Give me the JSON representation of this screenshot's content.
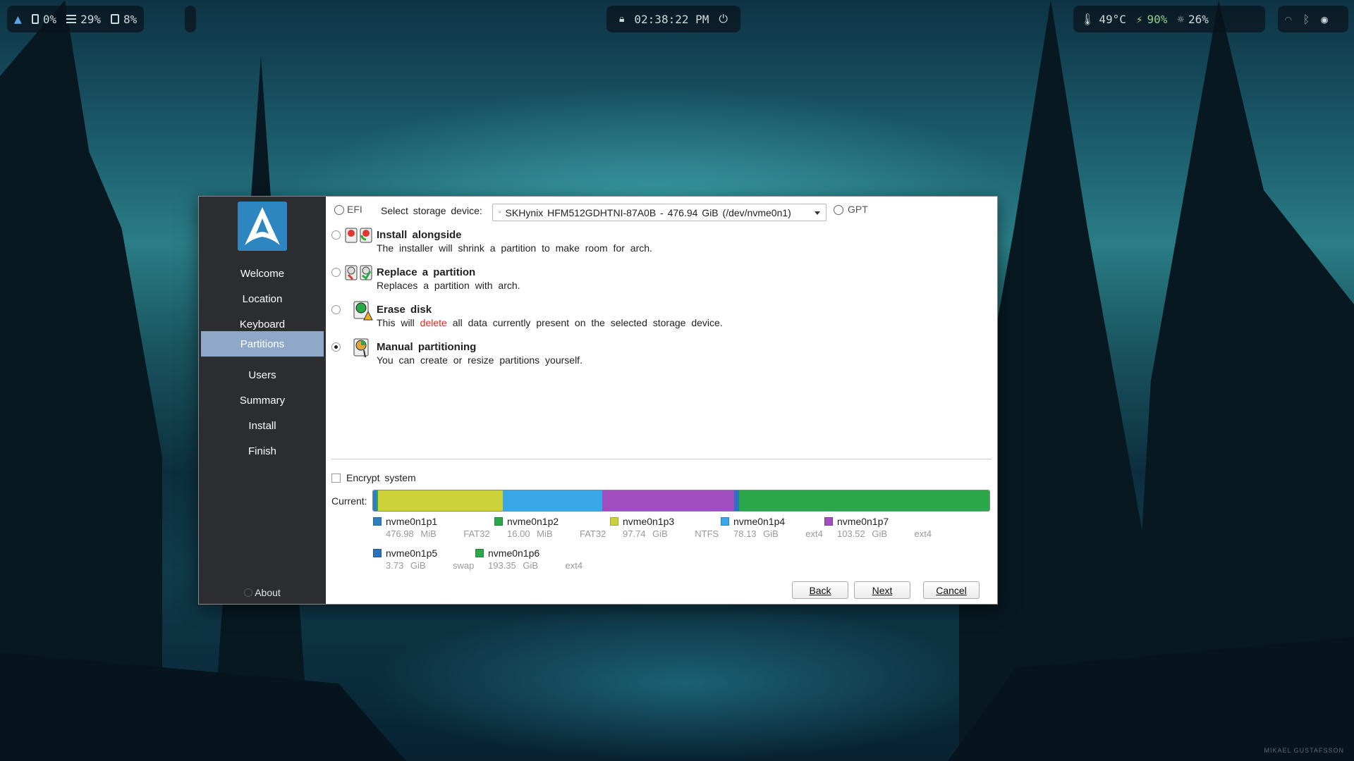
{
  "topbar": {
    "left": {
      "cpu": "0%",
      "memory": "29%",
      "disk": "8%"
    },
    "center": {
      "time": "02:38:22 PM"
    },
    "right": {
      "temperature": "49°C",
      "battery": "90%",
      "brightness": "26%"
    }
  },
  "sidebar": {
    "items": [
      {
        "label": "Welcome"
      },
      {
        "label": "Location"
      },
      {
        "label": "Keyboard"
      },
      {
        "label": "Partitions",
        "active": true
      },
      {
        "label": "Users"
      },
      {
        "label": "Summary"
      },
      {
        "label": "Install"
      },
      {
        "label": "Finish"
      }
    ],
    "about": "About"
  },
  "header": {
    "efi": "EFI",
    "select_label": "Select storage device:",
    "device": "SKHynix HFM512GDHTNI-87A0B - 476.94 GiB (/dev/nvme0n1)",
    "gpt": "GPT"
  },
  "options": [
    {
      "title": "Install alongside",
      "desc": "The installer will shrink a partition to make room for arch.",
      "selected": false
    },
    {
      "title": "Replace a partition",
      "desc": "Replaces a partition with arch.",
      "selected": false
    },
    {
      "title": "Erase disk",
      "desc_pre": "This will",
      "desc_red": "delete",
      "desc_post": "all data currently present on the selected storage device.",
      "selected": false
    },
    {
      "title": "Manual partitioning",
      "desc": "You can create or resize partitions yourself.",
      "selected": true
    }
  ],
  "encrypt_label": "Encrypt system",
  "current_label": "Current:",
  "partitions": [
    {
      "name": "nvme0n1p1",
      "size": "476.98 MiB",
      "fs": "FAT32",
      "color": "#2f7fbf"
    },
    {
      "name": "nvme0n1p2",
      "size": "16.00 MiB",
      "fs": "FAT32",
      "color": "#2aa84a"
    },
    {
      "name": "nvme0n1p3",
      "size": "97.74 GiB",
      "fs": "NTFS",
      "color": "#cdd23a"
    },
    {
      "name": "nvme0n1p4",
      "size": "78.13 GiB",
      "fs": "ext4",
      "color": "#3aa8e6"
    },
    {
      "name": "nvme0n1p7",
      "size": "103.52 GiB",
      "fs": "ext4",
      "color": "#a04dc0"
    },
    {
      "name": "nvme0n1p5",
      "size": "3.73 GiB",
      "fs": "swap",
      "color": "#2f6fbf"
    },
    {
      "name": "nvme0n1p6",
      "size": "193.35 GiB",
      "fs": "ext4",
      "color": "#2aa84a"
    }
  ],
  "buttons": {
    "back": "Back",
    "next": "Next",
    "cancel": "Cancel"
  },
  "credit": "MIKAEL GUSTAFSSON"
}
